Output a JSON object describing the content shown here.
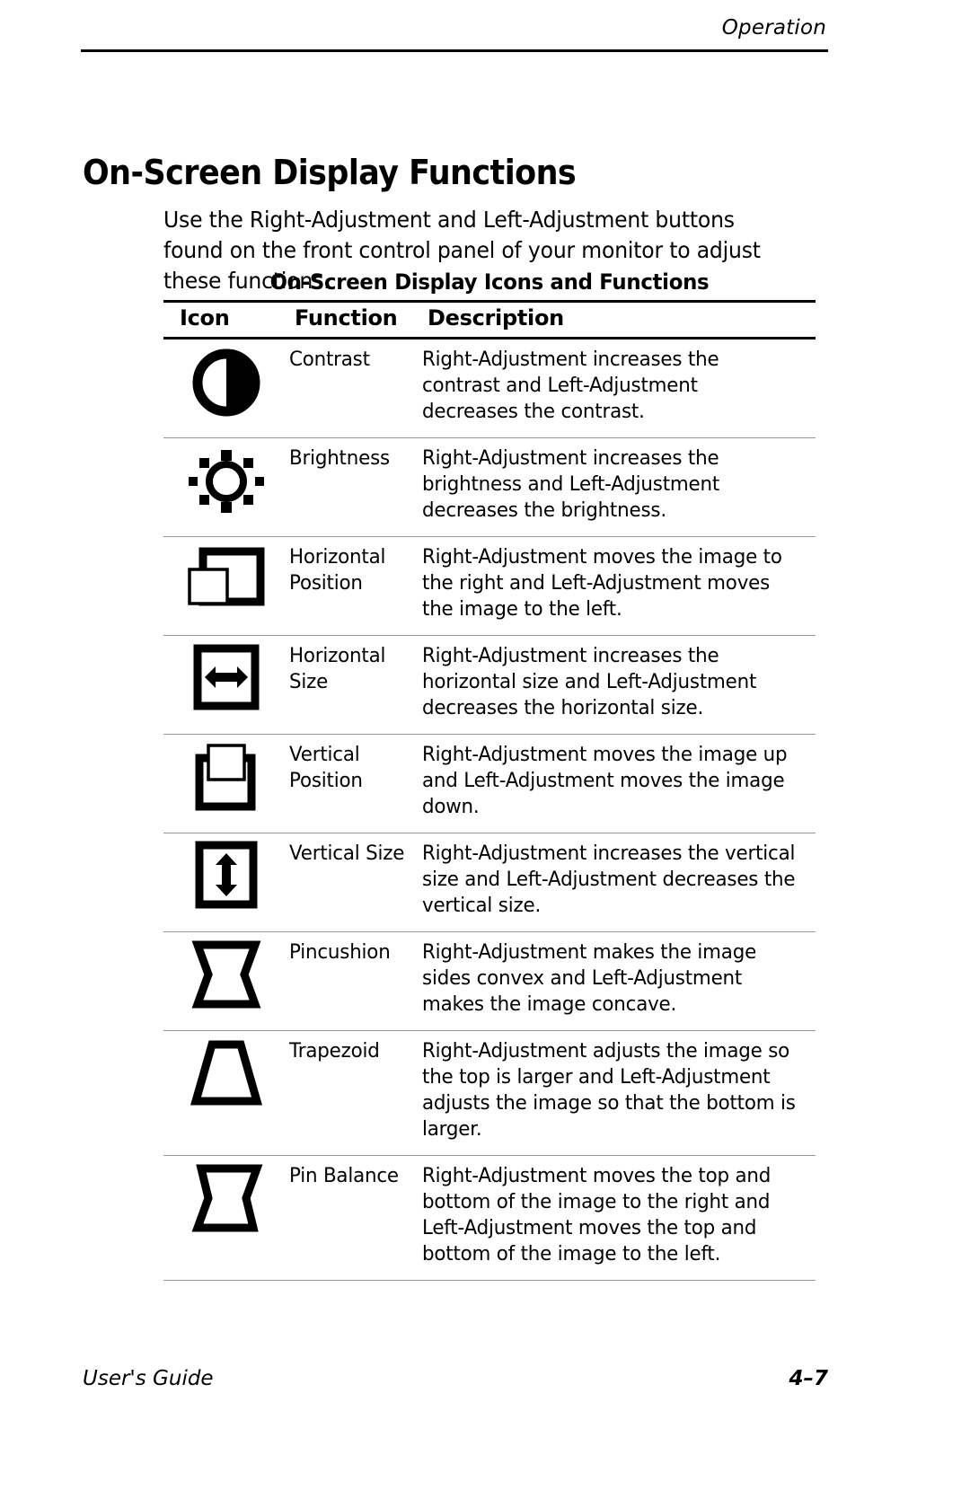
{
  "header": {
    "running_head": "Operation"
  },
  "heading": "On-Screen Display Functions",
  "intro": "Use the Right-Adjustment and Left-Adjustment buttons found on the front control panel of your monitor to adjust these functions.",
  "table": {
    "caption": "On-Screen Display Icons and Functions",
    "columns": [
      "Icon",
      "Function",
      "Description"
    ],
    "rows": [
      {
        "icon": "contrast-icon",
        "function": "Contrast",
        "description": "Right-Adjustment increases the contrast and Left-Adjustment decreases the contrast."
      },
      {
        "icon": "brightness-icon",
        "function": "Brightness",
        "description": "Right-Adjustment increases the brightness and Left-Adjustment decreases the brightness."
      },
      {
        "icon": "horizontal-position-icon",
        "function": "Horizontal Position",
        "description": "Right-Adjustment moves the image to the right and Left-Adjustment moves the image to the left."
      },
      {
        "icon": "horizontal-size-icon",
        "function": "Horizontal Size",
        "description": "Right-Adjustment increases the horizontal size and Left-Adjustment decreases the horizontal size."
      },
      {
        "icon": "vertical-position-icon",
        "function": "Vertical Position",
        "description": "Right-Adjustment moves the image up and Left-Adjustment moves the image down."
      },
      {
        "icon": "vertical-size-icon",
        "function": "Vertical Size",
        "description": "Right-Adjustment increases the vertical size and Left-Adjustment decreases the vertical size."
      },
      {
        "icon": "pincushion-icon",
        "function": "Pincushion",
        "description": "Right-Adjustment makes the image sides convex and Left-Adjustment makes the image concave."
      },
      {
        "icon": "trapezoid-icon",
        "function": "Trapezoid",
        "description": "Right-Adjustment adjusts the image so the top is larger and Left-Adjustment adjusts the image so that the bottom is larger."
      },
      {
        "icon": "pin-balance-icon",
        "function": "Pin Balance",
        "description": "Right-Adjustment moves the top and bottom of the image to the right and Left-Adjustment moves the top and bottom of the image to the left."
      }
    ]
  },
  "footer": {
    "left": "User's Guide",
    "page_number": "4–7"
  },
  "colors": {
    "ink": "#000000",
    "paper": "#ffffff",
    "rule_light": "#9a9a9a"
  }
}
